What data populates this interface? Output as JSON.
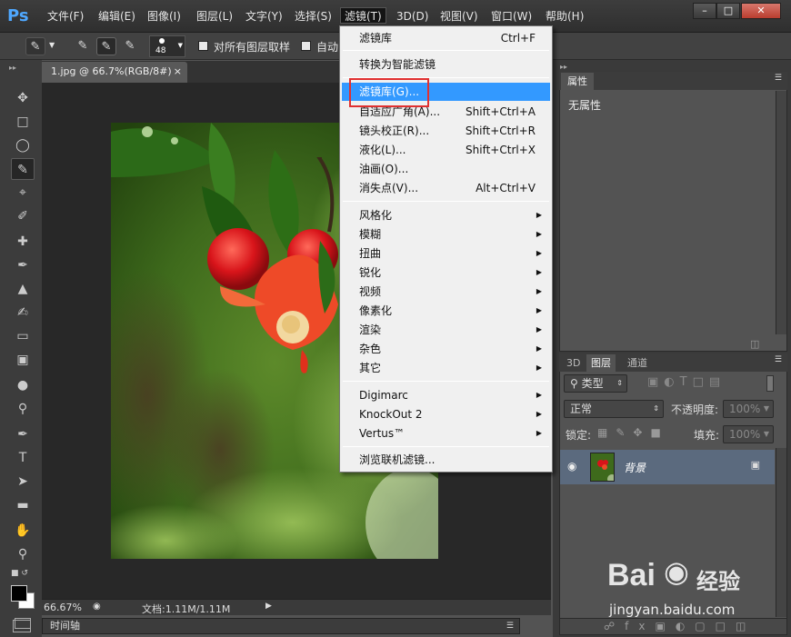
{
  "app": {
    "logo": "Ps",
    "menus": [
      "文件(F)",
      "编辑(E)",
      "图像(I)",
      "图层(L)",
      "文字(Y)",
      "选择(S)",
      "滤镜(T)",
      "3D(D)",
      "视图(V)",
      "窗口(W)",
      "帮助(H)"
    ],
    "active_menu_index": 6
  },
  "window_controls": {
    "minimize": "–",
    "restore": "□",
    "close": "✕"
  },
  "options_bar": {
    "brush_size": "48",
    "sample_all_layers": "对所有图层取样",
    "auto_label": "自动"
  },
  "document": {
    "tab_title": "1.jpg @ 66.7%(RGB/8#)",
    "zoom": "66.67%",
    "doc_info": "文档:1.11M/1.11M",
    "timeline": "时间轴"
  },
  "filter_menu": {
    "items": [
      {
        "label": "滤镜库",
        "shortcut": "Ctrl+F"
      },
      {
        "label": "转换为智能滤镜"
      },
      {
        "label": "滤镜库(G)...",
        "highlighted": true
      },
      {
        "label": "自适应广角(A)...",
        "shortcut": "Shift+Ctrl+A"
      },
      {
        "label": "镜头校正(R)...",
        "shortcut": "Shift+Ctrl+R"
      },
      {
        "label": "液化(L)...",
        "shortcut": "Shift+Ctrl+X"
      },
      {
        "label": "油画(O)..."
      },
      {
        "label": "消失点(V)...",
        "shortcut": "Alt+Ctrl+V"
      },
      {
        "label": "风格化",
        "submenu": true
      },
      {
        "label": "模糊",
        "submenu": true
      },
      {
        "label": "扭曲",
        "submenu": true
      },
      {
        "label": "锐化",
        "submenu": true
      },
      {
        "label": "视频",
        "submenu": true
      },
      {
        "label": "像素化",
        "submenu": true
      },
      {
        "label": "渲染",
        "submenu": true
      },
      {
        "label": "杂色",
        "submenu": true
      },
      {
        "label": "其它",
        "submenu": true
      },
      {
        "label": "Digimarc",
        "submenu": true
      },
      {
        "label": "KnockOut 2",
        "submenu": true
      },
      {
        "label": "Vertus™",
        "submenu": true
      },
      {
        "label": "浏览联机滤镜..."
      }
    ]
  },
  "properties_panel": {
    "tab": "属性",
    "content": "无属性"
  },
  "layers_panel": {
    "tabs": [
      "3D",
      "图层",
      "通道"
    ],
    "active_tab_index": 1,
    "filter_kind": "类型",
    "blend_mode": "正常",
    "opacity_label": "不透明度:",
    "opacity_value": "100%",
    "lock_label": "锁定:",
    "fill_label": "填充:",
    "fill_value": "100%",
    "layer_name": "背景"
  },
  "watermark": {
    "brand": "Bai",
    "brand_tail": "经验",
    "url": "jingyan.baidu.com"
  },
  "colors": {
    "highlight": "#3399ff",
    "annotation_box": "#e03030",
    "ps_blue": "#4fa8ff"
  }
}
